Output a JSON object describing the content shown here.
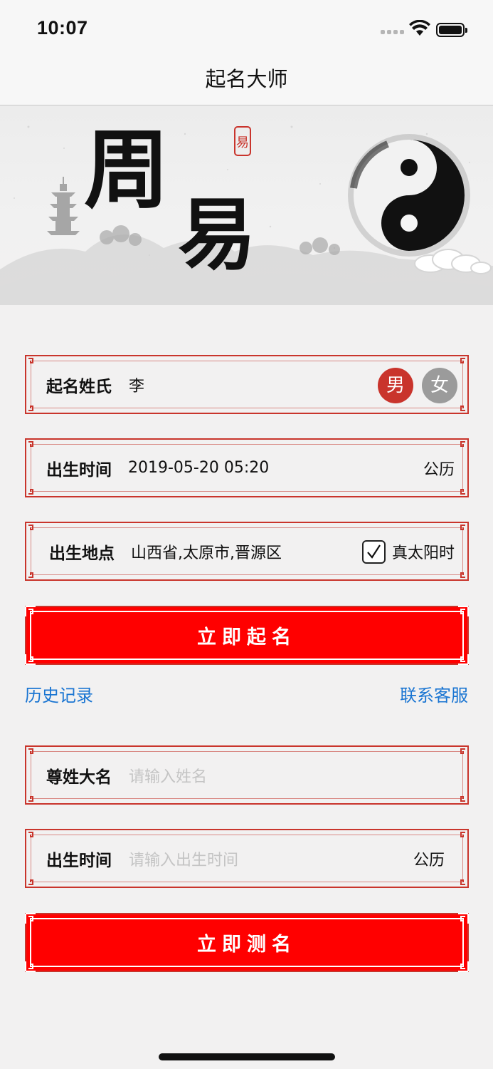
{
  "status_bar": {
    "time": "10:07"
  },
  "nav": {
    "title": "起名大师"
  },
  "banner": {
    "calligraphy_top": "周",
    "calligraphy_bottom": "易",
    "seal_text": "易",
    "image": "zhouyi-ink-painting-with-taiji-symbol"
  },
  "naming_form": {
    "surname": {
      "label": "起名姓氏",
      "value": "李"
    },
    "gender": {
      "male": "男",
      "female": "女",
      "selected": "男"
    },
    "birth_time": {
      "label": "出生时间",
      "value": "2019-05-20 05:20",
      "calendar": "公历"
    },
    "birth_place": {
      "label": "出生地点",
      "value": "山西省,太原市,晋源区",
      "true_solar_time_label": "真太阳时",
      "true_solar_time_checked": true
    },
    "submit": "立即起名"
  },
  "links": {
    "history": "历史记录",
    "contact": "联系客服"
  },
  "test_form": {
    "name": {
      "label": "尊姓大名",
      "placeholder": "请输入姓名"
    },
    "birth_time": {
      "label": "出生时间",
      "placeholder": "请输入出生时间",
      "calendar": "公历"
    },
    "submit": "立即测名"
  },
  "colors": {
    "accent_red": "#ff0000",
    "border_red": "#c9352c",
    "link_blue": "#1a75d2",
    "male_red": "#c9342c",
    "female_gray": "#9b9b9b"
  }
}
